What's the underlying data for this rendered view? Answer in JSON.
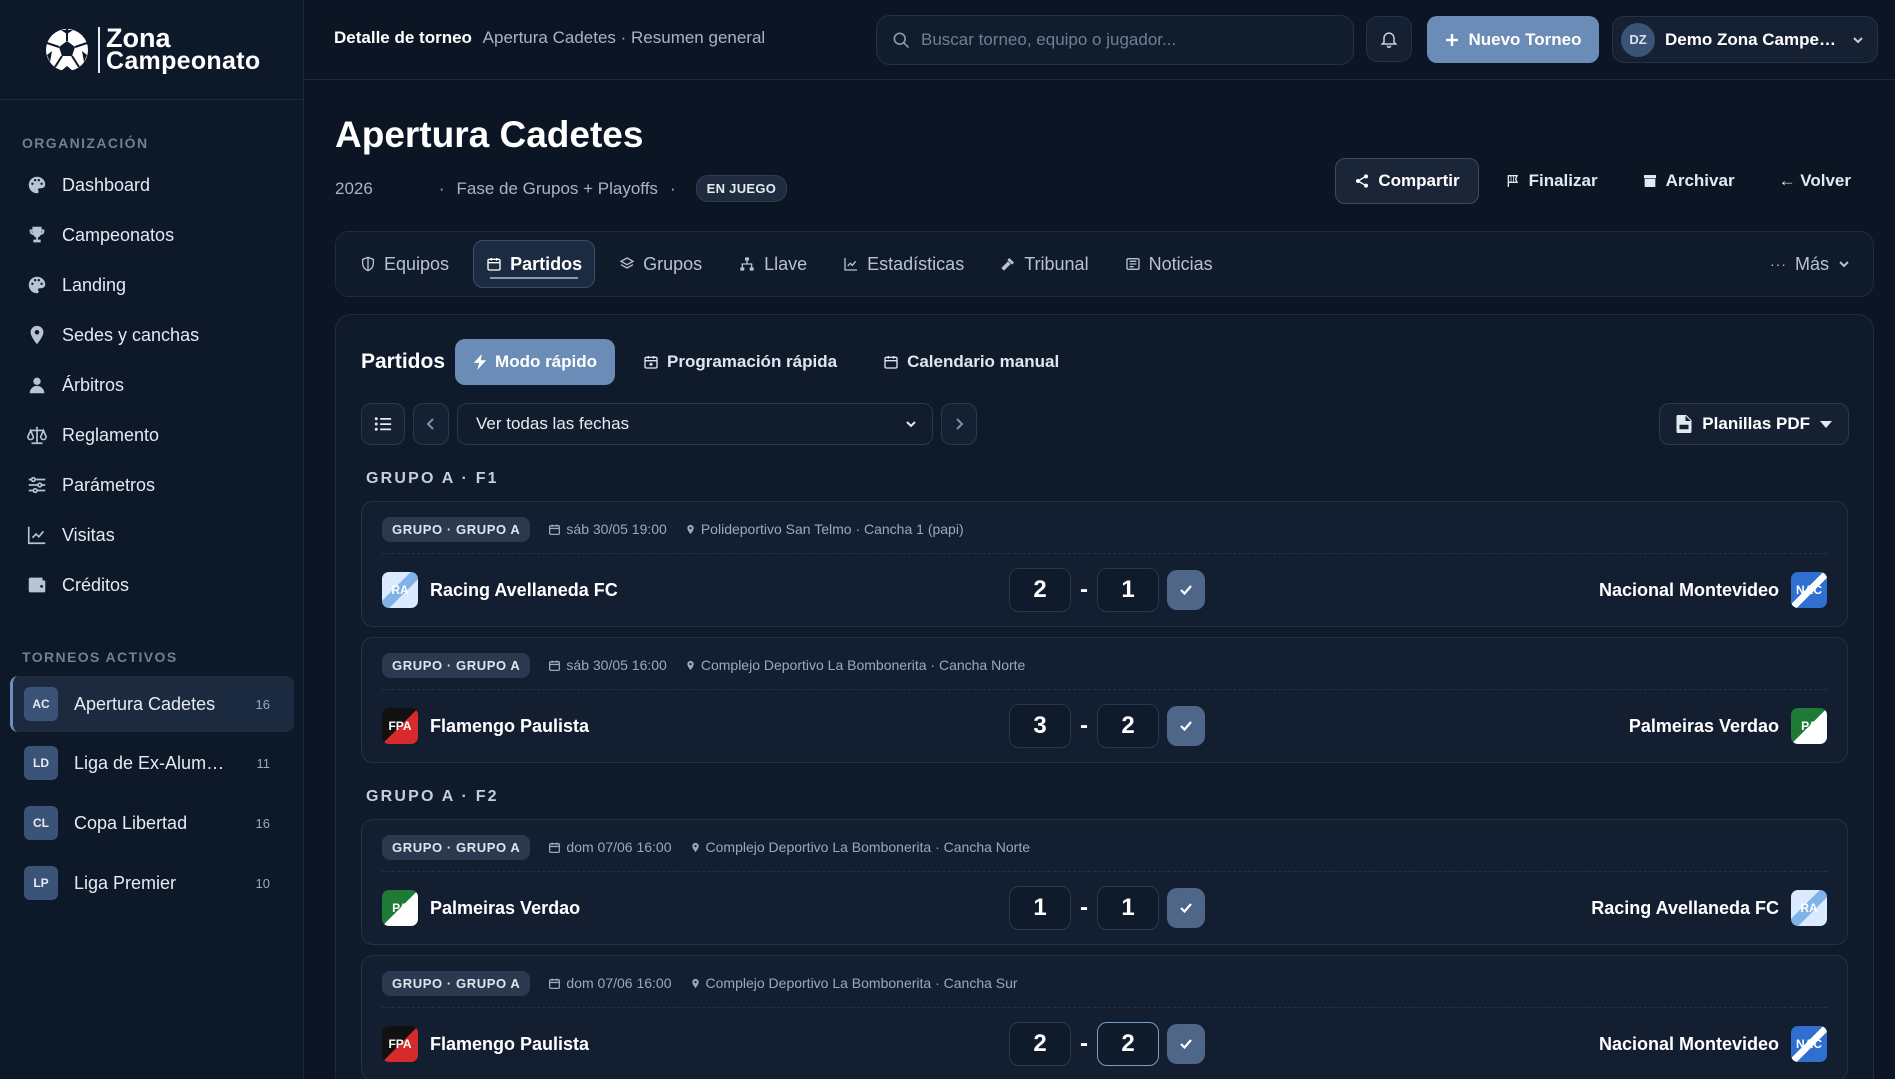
{
  "brand": {
    "line1": "Zona",
    "line2": "Campeonato"
  },
  "sidebar": {
    "org_title": "ORGANIZACIÓN",
    "items": [
      {
        "label": "Dashboard",
        "icon": "palette-icon"
      },
      {
        "label": "Campeonatos",
        "icon": "trophy-icon"
      },
      {
        "label": "Landing",
        "icon": "palette-icon"
      },
      {
        "label": "Sedes y canchas",
        "icon": "map-pin-icon"
      },
      {
        "label": "Árbitros",
        "icon": "user-icon"
      },
      {
        "label": "Reglamento",
        "icon": "scale-icon"
      },
      {
        "label": "Parámetros",
        "icon": "sliders-icon"
      },
      {
        "label": "Visitas",
        "icon": "chart-line-icon"
      },
      {
        "label": "Créditos",
        "icon": "wallet-icon"
      }
    ],
    "active_title": "TORNEOS ACTIVOS",
    "tournaments": [
      {
        "initials": "AC",
        "name": "Apertura Cadetes",
        "count": "16"
      },
      {
        "initials": "LD",
        "name": "Liga de Ex-Alumnos",
        "count": "11"
      },
      {
        "initials": "CL",
        "name": "Copa Libertad",
        "count": "16"
      },
      {
        "initials": "LP",
        "name": "Liga Premier",
        "count": "10"
      }
    ]
  },
  "topbar": {
    "crumb_strong": "Detalle de torneo",
    "crumb_muted": "Apertura Cadetes · Resumen general",
    "search_placeholder": "Buscar torneo, equipo o jugador...",
    "new_button": "Nuevo Torneo",
    "user_initials": "DZ",
    "user_name": "Demo Zona Campeonato"
  },
  "header": {
    "title": "Apertura Cadetes",
    "year": "2026",
    "format": "Fase de Grupos + Playoffs",
    "status": "EN JUEGO",
    "actions": {
      "share": "Compartir",
      "finish": "Finalizar",
      "archive": "Archivar",
      "back": "← Volver"
    }
  },
  "tabs": {
    "items": [
      "Equipos",
      "Partidos",
      "Grupos",
      "Llave",
      "Estadísticas",
      "Tribunal",
      "Noticias"
    ],
    "more": "Más",
    "active": "Partidos"
  },
  "matches": {
    "title": "Partidos",
    "modes": [
      "Modo rápido",
      "Programación rápida",
      "Calendario manual"
    ],
    "date_filter": "Ver todas las fechas",
    "pdf_button": "Planillas PDF",
    "groups": [
      {
        "label": "GRUPO A · F1"
      },
      {
        "label": "GRUPO A · F2"
      }
    ],
    "list": [
      {
        "badge": "GRUPO · GRUPO A",
        "date": "sáb 30/05 19:00",
        "venue": "Polideportivo San Telmo · Cancha 1 (papi)",
        "home": "Racing Avellaneda FC",
        "home_abbr": "RA",
        "home_score": "2",
        "away": "Nacional Montevideo",
        "away_abbr": "NAC",
        "away_score": "1"
      },
      {
        "badge": "GRUPO · GRUPO A",
        "date": "sáb 30/05 16:00",
        "venue": "Complejo Deportivo La Bombonerita · Cancha Norte",
        "home": "Flamengo Paulista",
        "home_abbr": "FPA",
        "home_score": "3",
        "away": "Palmeiras Verdao",
        "away_abbr": "PA",
        "away_score": "2"
      },
      {
        "badge": "GRUPO · GRUPO A",
        "date": "dom 07/06 16:00",
        "venue": "Complejo Deportivo La Bombonerita · Cancha Norte",
        "home": "Palmeiras Verdao",
        "home_abbr": "PA",
        "home_score": "1",
        "away": "Racing Avellaneda FC",
        "away_abbr": "RA",
        "away_score": "1"
      },
      {
        "badge": "GRUPO · GRUPO A",
        "date": "dom 07/06 16:00",
        "venue": "Complejo Deportivo La Bombonerita · Cancha Sur",
        "home": "Flamengo Paulista",
        "home_abbr": "FPA",
        "home_score": "2",
        "away": "Nacional Montevideo",
        "away_abbr": "NAC",
        "away_score": "2"
      }
    ]
  },
  "colors": {
    "accent": "#6b8cb6",
    "background": "#0c1524",
    "panel": "#0f1a2a"
  }
}
